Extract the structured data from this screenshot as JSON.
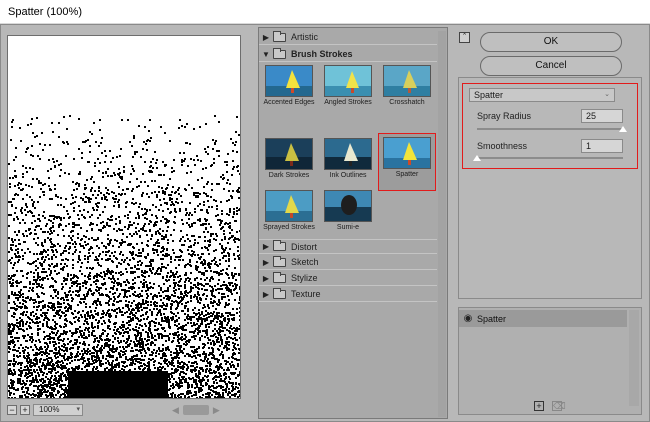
{
  "window": {
    "title": "Spatter (100%)"
  },
  "preview": {
    "zoom_level": "100%"
  },
  "gallery": {
    "categories_top": [
      {
        "label": "Artistic",
        "expanded": false
      },
      {
        "label": "Brush Strokes",
        "expanded": true
      }
    ],
    "thumbnails": [
      {
        "label": "Accented Edges"
      },
      {
        "label": "Angled Strokes"
      },
      {
        "label": "Crosshatch"
      },
      {
        "label": "Dark Strokes"
      },
      {
        "label": "Ink Outlines"
      },
      {
        "label": "Spatter",
        "selected": true
      },
      {
        "label": "Sprayed Strokes"
      },
      {
        "label": "Sumi-e"
      }
    ],
    "categories_bottom": [
      {
        "label": "Distort"
      },
      {
        "label": "Sketch"
      },
      {
        "label": "Stylize"
      },
      {
        "label": "Texture"
      }
    ]
  },
  "buttons": {
    "ok": "OK",
    "cancel": "Cancel"
  },
  "settings": {
    "filter_select": "Spatter",
    "params": [
      {
        "label": "Spray Radius",
        "value": "25",
        "slider_fraction": 1.0
      },
      {
        "label": "Smoothness",
        "value": "1",
        "slider_fraction": 0.0
      }
    ]
  },
  "layers": {
    "items": [
      {
        "name": "Spatter",
        "visible": true
      }
    ]
  },
  "colors": {
    "highlight": "#e21b1b",
    "dialog_bg": "#b8b8b8"
  },
  "icons": {
    "zoom_out": "minus-icon",
    "zoom_in": "plus-icon",
    "collapse": "collapse-arrow-icon",
    "eye": "eye-icon",
    "new_layer": "new-layer-icon",
    "delete_layer": "trash-icon"
  }
}
